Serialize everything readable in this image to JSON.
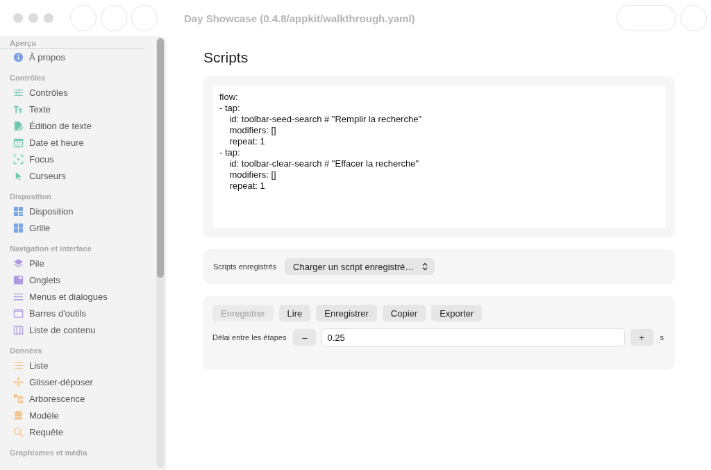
{
  "window": {
    "title": "Day Showcase (0.4.8/appkit/walkthrough.yaml)"
  },
  "sidebar": {
    "sections": [
      {
        "header": "Aperçu",
        "color": "#7a9fe6",
        "items": [
          {
            "label": "À propos",
            "kind": "info",
            "selected": false
          }
        ]
      },
      {
        "header": "Contrôles",
        "color": "#72c8b2",
        "items": [
          {
            "label": "Contrôles",
            "kind": "sliders",
            "selected": false
          },
          {
            "label": "Texte",
            "kind": "text",
            "selected": false
          },
          {
            "label": "Édition de texte",
            "kind": "doc",
            "selected": false
          },
          {
            "label": "Date et heure",
            "kind": "calendar",
            "selected": false
          },
          {
            "label": "Focus",
            "kind": "focus",
            "selected": false
          },
          {
            "label": "Curseurs",
            "kind": "cursor",
            "selected": false
          }
        ]
      },
      {
        "header": "Disposition",
        "color": "#7aa6e6",
        "items": [
          {
            "label": "Disposition",
            "kind": "layout",
            "selected": false
          },
          {
            "label": "Grille",
            "kind": "grid",
            "selected": false
          }
        ]
      },
      {
        "header": "Navigation et interface",
        "color": "#ad9ae0",
        "items": [
          {
            "label": "Pile",
            "kind": "stack",
            "selected": false
          },
          {
            "label": "Onglets",
            "kind": "tabs",
            "selected": false
          },
          {
            "label": "Menus et dialogues",
            "kind": "menu",
            "selected": false
          },
          {
            "label": "Barres d'outils",
            "kind": "window",
            "selected": false
          },
          {
            "label": "Liste de contenu",
            "kind": "columns",
            "selected": false
          }
        ]
      },
      {
        "header": "Données",
        "color": "#f2c48e",
        "items": [
          {
            "label": "Liste",
            "kind": "list",
            "selected": false
          },
          {
            "label": "Glisser-déposer",
            "kind": "move",
            "selected": false
          },
          {
            "label": "Arborescence",
            "kind": "tree",
            "selected": false
          },
          {
            "label": "Modèle",
            "kind": "db",
            "selected": false
          },
          {
            "label": "Requête",
            "kind": "search",
            "selected": false
          }
        ]
      },
      {
        "header": "Graphismes et média"
      }
    ]
  },
  "page": {
    "title": "Scripts",
    "script_lines": [
      "flow:",
      "- tap:",
      "    id: toolbar-seed-search # \"Remplir la recherche\"",
      "    modifiers: []",
      "    repeat: 1",
      "- tap:",
      "    id: toolbar-clear-search # \"Effacer la recherche\"",
      "    modifiers: []",
      "    repeat: 1"
    ],
    "saved_scripts": {
      "label": "Scripts enregistrés",
      "value": "Charger un script enregistré…"
    },
    "buttons": [
      {
        "label": "Enregistrer",
        "disabled": true
      },
      {
        "label": "Lire",
        "disabled": false
      },
      {
        "label": "Enregistrer",
        "disabled": false
      },
      {
        "label": "Copier",
        "disabled": false
      },
      {
        "label": "Exporter",
        "disabled": false
      }
    ],
    "delay": {
      "label": "Délai entre les étapes",
      "minus": "–",
      "value": "0.25",
      "plus": "+",
      "unit": "s"
    }
  }
}
